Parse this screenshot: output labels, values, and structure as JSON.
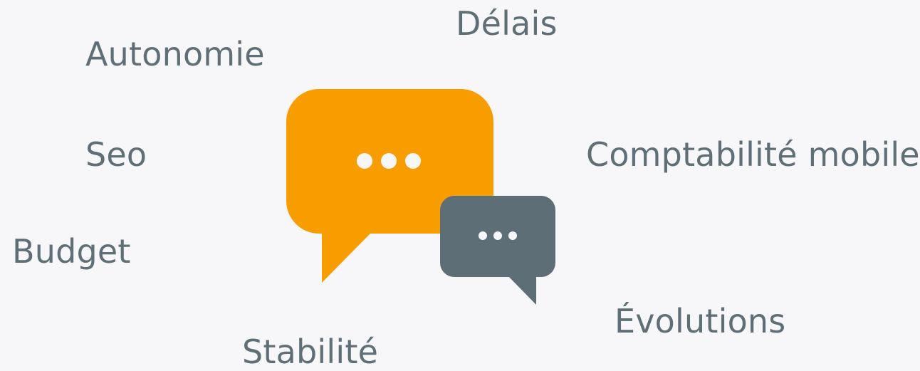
{
  "words": {
    "delais": "Délais",
    "autonomie": "Autonomie",
    "seo": "Seo",
    "comptabilite": "Comptabilité mobile",
    "budget": "Budget",
    "evolutions": "Évolutions",
    "stabilite": "Stabilité"
  },
  "icons": {
    "large_bubble": "speech-bubble-icon",
    "small_bubble": "speech-bubble-icon"
  },
  "colors": {
    "background": "#f7f7f9",
    "text": "#5f6f77",
    "orange_bubble": "#f89d00",
    "gray_bubble": "#5d6e76",
    "dots": "#f7f7f9"
  }
}
